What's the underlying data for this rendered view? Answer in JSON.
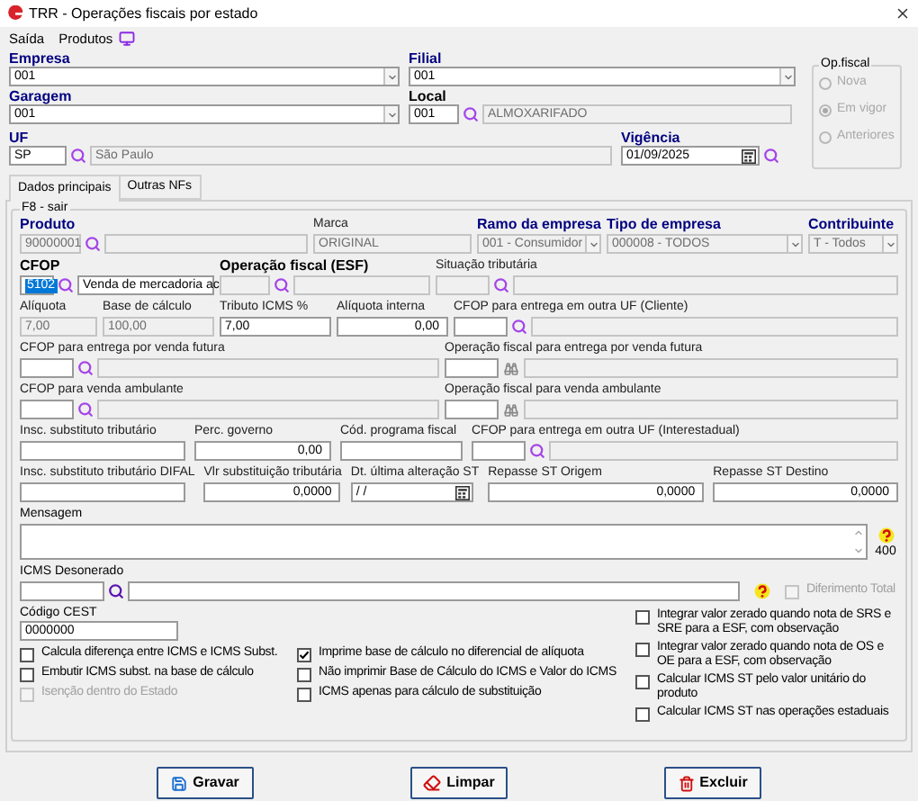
{
  "window": {
    "title": "TRR - Operações fiscais por estado"
  },
  "menu": [
    {
      "label": "Saída"
    },
    {
      "label": "Produtos"
    }
  ],
  "header": {
    "empresa": {
      "label": "Empresa",
      "required": true,
      "bold": true,
      "value": "001"
    },
    "filial": {
      "label": "Filial",
      "required": true,
      "bold": true,
      "value": "001"
    },
    "garagem": {
      "label": "Garagem",
      "required": true,
      "bold": true,
      "value": "001"
    },
    "local": {
      "label": "Local",
      "required": false,
      "bold": true,
      "code": "001",
      "name": "ALMOXARIFADO"
    },
    "uf": {
      "label": "UF",
      "required": true,
      "bold": true,
      "code": "SP",
      "name": "São Paulo"
    },
    "vigencia": {
      "label": "Vigência",
      "required": true,
      "bold": true,
      "value": "01/09/2025"
    }
  },
  "op_fiscal": {
    "title": "Op.fiscal",
    "options": [
      {
        "label": "Nova",
        "selected": false,
        "disabled": true
      },
      {
        "label": "Em vigor",
        "selected": true,
        "disabled": true
      },
      {
        "label": "Anteriores",
        "selected": false,
        "disabled": true
      }
    ]
  },
  "tabs": [
    {
      "label": "Dados principais",
      "selected": true
    },
    {
      "label": "Outras NFs",
      "selected": false
    }
  ],
  "group_title": "F8 - sair",
  "rows": [
    [
      {
        "kind": "lookup",
        "label": "Produto",
        "required": true,
        "bold": true,
        "code": "90000001",
        "highlighted": false,
        "disabled": true,
        "name_disabled": true
      },
      {
        "kind": "text",
        "label": "Marca",
        "required": false,
        "bold": false,
        "value": "ORIGINAL",
        "disabled": true
      },
      {
        "kind": "combo",
        "label": "Ramo da empresa",
        "required": true,
        "bold": true,
        "value": "001 - Consumidor",
        "disabled": true
      },
      {
        "kind": "combo",
        "label": "Tipo de empresa",
        "required": true,
        "bold": true,
        "value": "000008 - TODOS",
        "disabled": true
      },
      {
        "kind": "combo",
        "label": "Contribuinte",
        "required": true,
        "bold": true,
        "value": "T - Todos",
        "disabled": true
      }
    ],
    [
      {
        "kind": "lookup",
        "label": "CFOP",
        "required": false,
        "bold": true,
        "code": "5102",
        "highlighted": true,
        "disabled": false,
        "name": "Venda de mercadoria ac",
        "name_disabled": false
      },
      {
        "kind": "lookup",
        "label": "Operação fiscal (ESF)",
        "required": false,
        "bold": true,
        "disabled": true,
        "name_disabled": true
      },
      {
        "kind": "lookup",
        "label": "Situação tributária",
        "required": false,
        "bold": false,
        "disabled": true,
        "name_disabled": true
      }
    ],
    [
      {
        "kind": "text",
        "label": "Alíquota",
        "required": false,
        "bold": false,
        "value": "7,00",
        "disabled": true
      },
      {
        "kind": "text",
        "label": "Base de cálculo",
        "required": false,
        "bold": false,
        "value": "100,00",
        "disabled": true
      },
      {
        "kind": "text",
        "label": "Tributo ICMS %",
        "required": false,
        "bold": false,
        "value": "7,00",
        "disabled": false
      },
      {
        "kind": "number",
        "label": "Alíquota interna",
        "required": false,
        "bold": false,
        "value": "0,00",
        "disabled": false
      },
      {
        "kind": "lookup",
        "label": "CFOP para entrega em outra UF (Cliente)",
        "required": false,
        "bold": false,
        "disabled": false,
        "name_disabled": true
      }
    ],
    [
      {
        "kind": "lookup",
        "label": "CFOP para entrega por venda futura",
        "required": false,
        "bold": false,
        "disabled": false,
        "name_disabled": true
      },
      {
        "kind": "locate",
        "label": "Operação fiscal para entrega por venda futura",
        "required": false,
        "bold": false,
        "disabled": false,
        "name_disabled": true
      }
    ],
    [
      {
        "kind": "lookup",
        "label": "CFOP para venda ambulante",
        "required": false,
        "bold": false,
        "disabled": false,
        "name_disabled": true
      },
      {
        "kind": "locate",
        "label": "Operação fiscal para venda ambulante",
        "required": false,
        "bold": false,
        "disabled": false,
        "name_disabled": true
      }
    ],
    [
      {
        "kind": "text",
        "label": "Insc. substituto tributário",
        "required": false,
        "bold": false,
        "disabled": false
      },
      {
        "kind": "number",
        "label": "Perc. governo",
        "required": false,
        "bold": false,
        "value": "0,00",
        "disabled": false
      },
      {
        "kind": "text",
        "label": "Cód. programa fiscal",
        "required": false,
        "bold": false,
        "disabled": false
      },
      {
        "kind": "lookup",
        "label": "CFOP para entrega em outra UF (Interestadual)",
        "required": false,
        "bold": false,
        "disabled": false,
        "name_disabled": true
      }
    ],
    [
      {
        "kind": "text",
        "label": "Insc. substituto tributário DIFAL",
        "required": false,
        "bold": false,
        "disabled": false
      },
      {
        "kind": "number",
        "label": "Vlr substituição tributária",
        "required": false,
        "bold": false,
        "value": "0,0000",
        "disabled": false
      },
      {
        "kind": "date",
        "label": "Dt. última alteração ST",
        "required": false,
        "bold": false,
        "value": " / /",
        "disabled": false
      },
      {
        "kind": "number",
        "label": "Repasse ST Origem",
        "required": false,
        "bold": false,
        "value": "0,0000",
        "disabled": false
      },
      {
        "kind": "number",
        "label": "Repasse ST Destino",
        "required": false,
        "bold": false,
        "value": "0,0000",
        "disabled": false
      }
    ]
  ],
  "mensagem": {
    "label": "Mensagem",
    "counter": "400"
  },
  "icms_desonerado": {
    "label": "ICMS Desonerado",
    "diferimento": {
      "label": "Diferimento Total",
      "checked": false,
      "disabled": true
    }
  },
  "cest": {
    "label": "Código CEST",
    "value": "0000000"
  },
  "checkbox_columns": [
    [
      {
        "label": "Calcula diferença entre ICMS e ICMS Subst.",
        "checked": false,
        "disabled": false
      },
      {
        "label": "Embutir ICMS subst. na base de cálculo",
        "checked": false,
        "disabled": false
      },
      {
        "label": "Isenção dentro do Estado",
        "checked": false,
        "disabled": true
      }
    ],
    [
      {
        "label": "Imprime base de cálculo no diferencial de alíquota",
        "checked": true,
        "disabled": false
      },
      {
        "label": "Não imprimir Base de Cálculo do ICMS e Valor do ICMS",
        "checked": false,
        "disabled": false
      },
      {
        "label": "ICMS apenas para cálculo de substituição",
        "checked": false,
        "disabled": false
      }
    ],
    [
      {
        "label": "Integrar valor zerado quando nota de SRS e SRE para a ESF, com observação",
        "checked": false,
        "disabled": false
      },
      {
        "label": "Integrar valor zerado quando nota de OS e OE para a ESF, com observação",
        "checked": false,
        "disabled": false
      },
      {
        "label": "Calcular ICMS ST pelo valor unitário do produto",
        "checked": false,
        "disabled": false
      },
      {
        "label": "Calcular ICMS ST nas operações estaduais",
        "checked": false,
        "disabled": false
      }
    ]
  ],
  "buttons": [
    {
      "label": "Gravar",
      "kind": "save"
    },
    {
      "label": "Limpar",
      "kind": "clear"
    },
    {
      "label": "Excluir",
      "kind": "delete"
    }
  ]
}
